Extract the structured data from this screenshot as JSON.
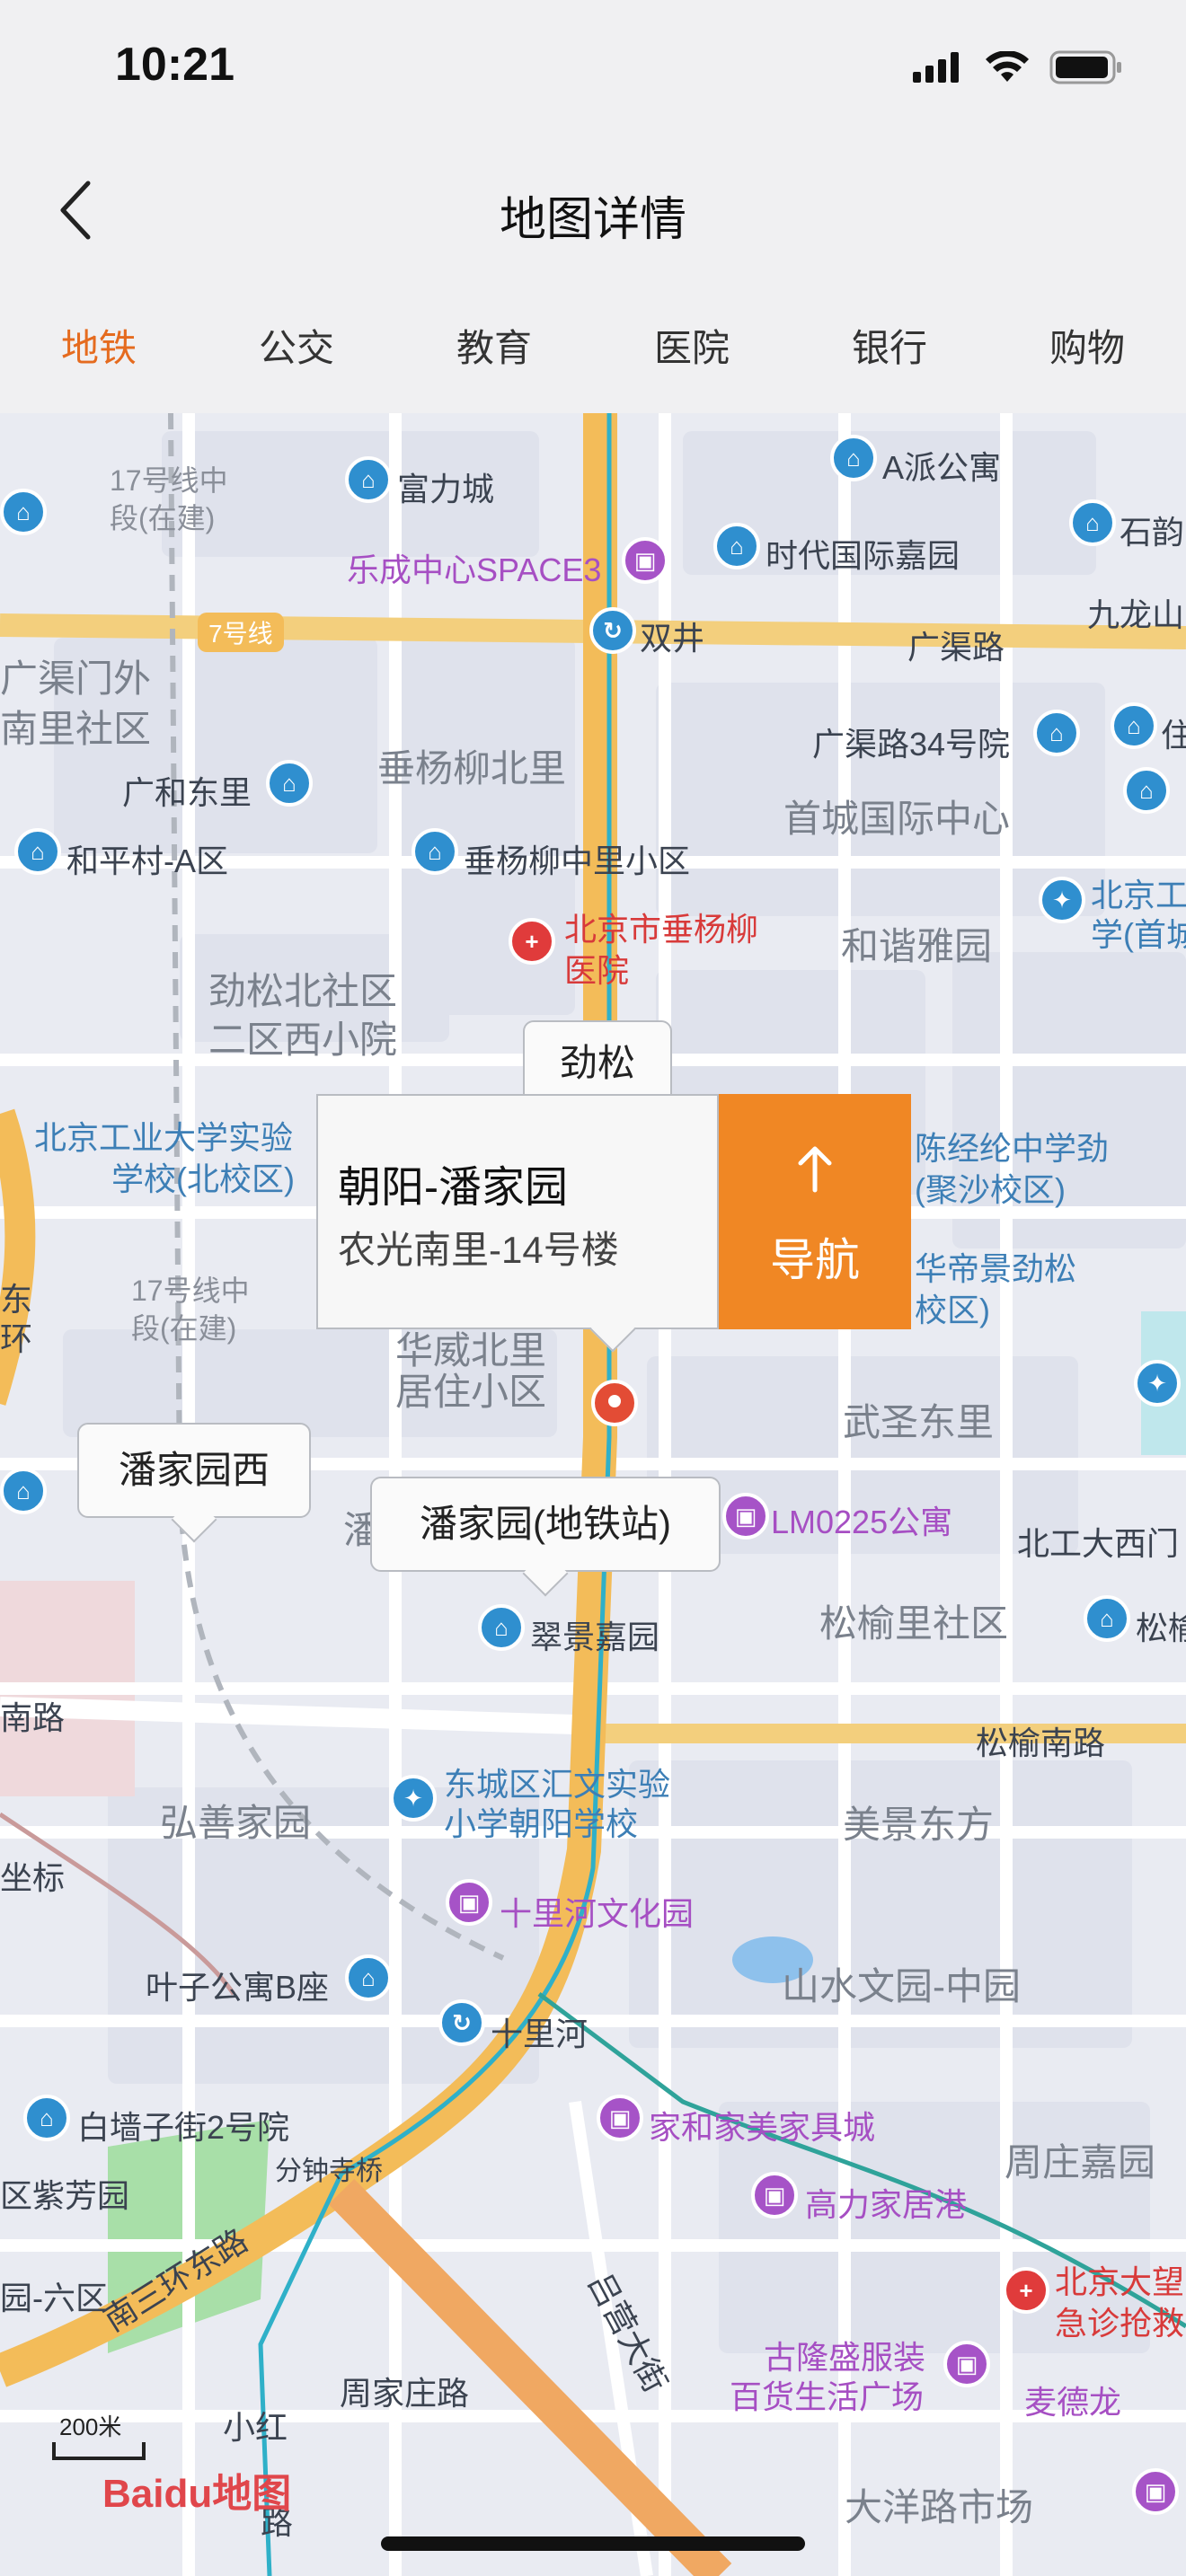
{
  "status_bar": {
    "time": "10:21"
  },
  "header": {
    "title": "地图详情"
  },
  "tabs": [
    {
      "label": "地铁",
      "active": true
    },
    {
      "label": "公交",
      "active": false
    },
    {
      "label": "教育",
      "active": false
    },
    {
      "label": "医院",
      "active": false
    },
    {
      "label": "银行",
      "active": false
    },
    {
      "label": "购物",
      "active": false
    }
  ],
  "map": {
    "info_window": {
      "title": "朝阳-潘家园",
      "address": "农光南里-14号楼",
      "nav_label": "导航"
    },
    "station_bubbles": [
      "劲松",
      "潘家园西",
      "潘家园(地铁站)"
    ],
    "labels": {
      "l1": "17号线中",
      "l1b": "段(在建)",
      "l2": "富力城",
      "l3": "A派公寓",
      "l4": "石韵",
      "l5": "乐成中心SPACE3",
      "l6": "时代国际嘉园",
      "l7": "7号线",
      "l8": "双井",
      "l9": "广渠路",
      "l10": "九龙山",
      "l11": "广渠门外",
      "l12": "南里社区",
      "l13": "广渠路34号院",
      "l14": "住",
      "l15": "广和东里",
      "l16": "垂杨柳北里",
      "l17": "首城国际中心",
      "l18": "和平村-A区",
      "l19": "垂杨柳中里小区",
      "l20": "北京市垂杨柳",
      "l20b": "医院",
      "l21": "和谐雅园",
      "l22": "北京工",
      "l22b": "学(首城",
      "l23": "劲松北社区",
      "l23b": "二区西小院",
      "l24": "北京工业大学实验",
      "l24b": "学校(北校区)",
      "l25": "陈经纶中学劲",
      "l25b": "(聚沙校区)",
      "l26": "华帝景劲松",
      "l26b": "校区)",
      "l27": "17号线中",
      "l27b": "段(在建)",
      "l28": "华威北里",
      "l28b": "居住小区",
      "l29": "武圣东里",
      "l30": "东",
      "l30b": "环",
      "l31": "LM0225公寓",
      "l32": "北工大西门",
      "l33": "翠景嘉园",
      "l34": "松榆里社区",
      "l35": "松榆",
      "l36": "南路",
      "l37": "松榆南路",
      "l38": "东城区汇文实验",
      "l38b": "小学朝阳学校",
      "l39": "弘善家园",
      "l40": "美景东方",
      "l41": "坐标",
      "l42": "十里河文化园",
      "l43": "叶子公寓B座",
      "l44": "十里河",
      "l45": "山水文园-中园",
      "l46": "白墙子街2号院",
      "l47": "家和家美家具城",
      "l48": "分钟寺桥",
      "l49": "周庄嘉园",
      "l50": "区紫芳园",
      "l51": "高力家居港",
      "l52": "北京大望",
      "l52b": "急诊抢救",
      "l53": "园-六区",
      "l54": "南三环东路",
      "l55": "吕营大街",
      "l56": "古隆盛服装",
      "l56b": "百货生活广场",
      "l57": "麦德龙",
      "l58": "周家庄路",
      "l59": "小红",
      "l59b": "路",
      "l60": "大洋路市场",
      "l61": "潘"
    },
    "scale_label": "200米",
    "logo": "Baidu地图"
  }
}
